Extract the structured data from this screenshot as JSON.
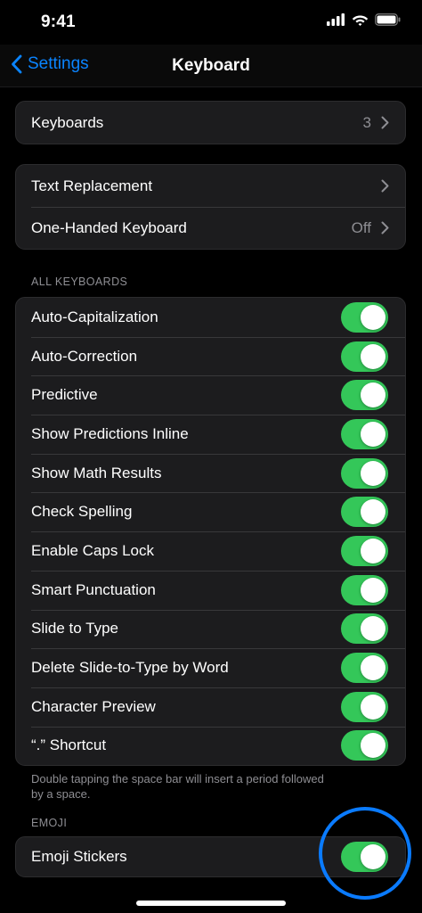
{
  "status": {
    "time": "9:41"
  },
  "nav": {
    "back_label": "Settings",
    "title": "Keyboard"
  },
  "keyboards_row": {
    "label": "Keyboards",
    "value": "3"
  },
  "text_group": [
    {
      "label": "Text Replacement",
      "value": ""
    },
    {
      "label": "One-Handed Keyboard",
      "value": "Off"
    }
  ],
  "all_keyboards": {
    "header": "ALL KEYBOARDS",
    "toggles": [
      {
        "label": "Auto-Capitalization",
        "on": true
      },
      {
        "label": "Auto-Correction",
        "on": true
      },
      {
        "label": "Predictive",
        "on": true
      },
      {
        "label": "Show Predictions Inline",
        "on": true
      },
      {
        "label": "Show Math Results",
        "on": true
      },
      {
        "label": "Check Spelling",
        "on": true
      },
      {
        "label": "Enable Caps Lock",
        "on": true
      },
      {
        "label": "Smart Punctuation",
        "on": true
      },
      {
        "label": "Slide to Type",
        "on": true
      },
      {
        "label": "Delete Slide-to-Type by Word",
        "on": true
      },
      {
        "label": "Character Preview",
        "on": true
      },
      {
        "label": "“.” Shortcut",
        "on": true
      }
    ],
    "footer": "Double tapping the space bar will insert a period followed by a space."
  },
  "emoji": {
    "header": "EMOJI",
    "toggle": {
      "label": "Emoji Stickers",
      "on": true
    }
  },
  "colors": {
    "accent": "#0a84ff",
    "toggle_on": "#34c759",
    "highlight": "#0a7bff",
    "group_bg": "#1c1c1e"
  }
}
